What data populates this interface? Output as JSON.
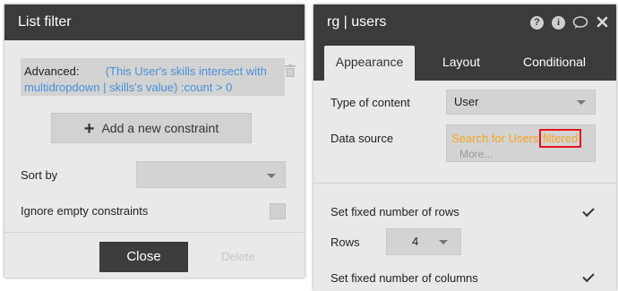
{
  "list_filter": {
    "title": "List filter",
    "advanced_label": "Advanced:",
    "advanced_expr_line1": "(This User's skills intersect with",
    "advanced_expr_line2": "multidropdown | skills's value)",
    "advanced_suffix": ":count > 0",
    "add_constraint_label": "Add a new constraint",
    "sort_by_label": "Sort by",
    "sort_by_value": "",
    "ignore_empty_label": "Ignore empty constraints",
    "ignore_empty_checked": false,
    "close_label": "Close",
    "delete_label": "Delete"
  },
  "property_editor": {
    "title": "rg | users",
    "tabs": [
      {
        "label": "Appearance",
        "active": true
      },
      {
        "label": "Layout",
        "active": false
      },
      {
        "label": "Conditional",
        "active": false
      }
    ],
    "type_of_content_label": "Type of content",
    "type_of_content_value": "User",
    "data_source_label": "Data source",
    "data_source_part1": "Search for Users:",
    "data_source_part2": "filtered",
    "data_source_more": "More...",
    "fixed_rows_label": "Set fixed number of rows",
    "fixed_rows_checked": true,
    "rows_label": "Rows",
    "rows_value": "4",
    "fixed_columns_label": "Set fixed number of columns",
    "fixed_columns_checked": true
  },
  "colors": {
    "accent_orange": "#f5a623",
    "link_blue": "#4a90d9",
    "highlight_red": "#e8141c"
  }
}
